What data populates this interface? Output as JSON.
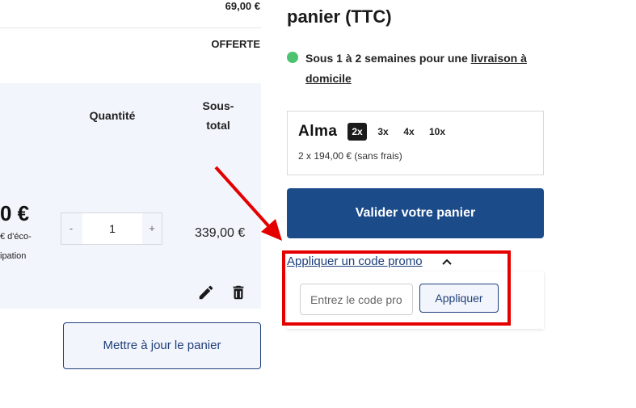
{
  "left": {
    "top_price": "69,00 €",
    "shipping_value": "OFFERTE",
    "cart_headers": {
      "quantity": "Quantité",
      "subtotal_line1": "Sous-",
      "subtotal_line2": "total"
    },
    "item": {
      "unit_price_partial": "0 €",
      "eco_line1": "€ d'éco-",
      "eco_line2": "ipation",
      "quantity": "1",
      "minus_label": "-",
      "plus_label": "+",
      "subtotal": "339,00 €",
      "edit_icon": "pencil-icon",
      "delete_icon": "trash-icon"
    },
    "update_button": "Mettre à jour le panier"
  },
  "summary": {
    "title": "panier (TTC)",
    "delivery_prefix": "Sous 1 à 2 semaines pour une ",
    "delivery_link_part1": "livraison à",
    "delivery_link_part2": "domicile",
    "status_color": "#4cc36f"
  },
  "alma": {
    "logo": "Alma",
    "options": [
      "2x",
      "3x",
      "4x",
      "10x"
    ],
    "selected": "2x",
    "description": "2 x 194,00 € (sans frais)"
  },
  "validate_button": "Valider votre panier",
  "promo": {
    "toggle_label": "Appliquer un code promo",
    "placeholder": "Entrez le code promo",
    "apply_button": "Appliquer"
  },
  "colors": {
    "primary": "#1c4b8a",
    "annotation": "#e50000",
    "panel_bg": "#f3f5fc"
  }
}
